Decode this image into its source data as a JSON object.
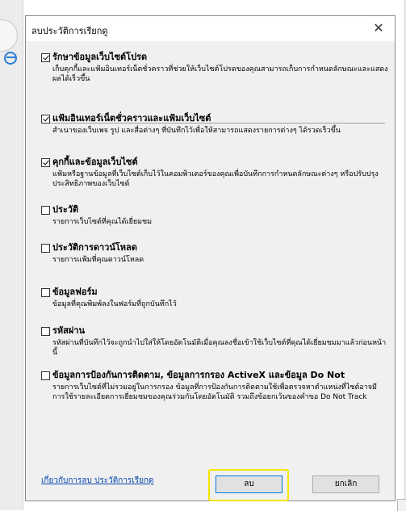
{
  "dialog": {
    "title": "ลบประวัติการเรียกดู",
    "close_label": "✕"
  },
  "options": [
    {
      "checked": true,
      "label": "รักษาข้อมูลเว็บไซต์โปรด",
      "description": "เก็บคุกกี้และแฟ้มอินเทอร์เน็ตชั่วคราวที่ช่วยให้เว็บไซต์โปรดของคุณสามารถเก็บการกำหนดลักษณะและแสดงผลได้เร็วขึ้น"
    },
    {
      "checked": true,
      "label": "แฟ้มอินเทอร์เน็ตชั่วคราวและแฟ้มเว็บไซต์",
      "description": "สำเนาของเว็บเพจ รูป และสื่อต่างๆ ที่บันทึกไว้เพื่อให้สามารถแสดงรายการต่างๆ ได้รวดเร็วขึ้น"
    },
    {
      "checked": true,
      "label": "คุกกี้และข้อมูลเว็บไซต์",
      "description": "แฟ้มหรือฐานข้อมูลที่เว็บไซต์เก็บไว้ในคอมพิวเตอร์ของคุณเพื่อบันทึกการกำหนดลักษณะต่างๆ หรือปรับปรุงประสิทธิภาพของเว็บไซต์"
    },
    {
      "checked": false,
      "label": "ประวัติ",
      "description": "รายการเว็บไซต์ที่คุณได้เยี่ยมชม"
    },
    {
      "checked": false,
      "label": "ประวัติการดาวน์โหลด",
      "description": "รายการแฟ้มที่คุณดาวน์โหลด"
    },
    {
      "checked": false,
      "label": "ข้อมูลฟอร์ม",
      "description": "ข้อมูลที่คุณพิมพ์ลงในฟอร์มที่ถูกบันทึกไว้"
    },
    {
      "checked": false,
      "label": "รหัสผ่าน",
      "description": "รหัสผ่านที่บันทึกไว้จะถูกนำไปใส่ให้โดยอัตโนมัติเมื่อคุณลงชื่อเข้าใช้เว็บไซต์ที่คุณได้เยี่ยมชมมาแล้วก่อนหน้านี้"
    },
    {
      "checked": false,
      "label": "ข้อมูลการป้องกันการติดตาม, ข้อมูลการกรอง ActiveX และข้อมูล Do Not",
      "description": "รายการเว็บไซต์ที่ไม่รวมอยู่ในการกรอง ข้อมูลที่การป้องกันการติดตามใช้เพื่อตรวจหาตำแหน่งที่ไซต์อาจมีการใช้รายละเอียดการเยี่ยมชมของคุณร่วมกันโดยอัตโนมัติ รวมถึงข้อยกเว้นของคำขอ Do Not Track"
    }
  ],
  "footer": {
    "link_label": "เกี่ยวกับการลบ ประวัติการเรียกดู",
    "delete_label": "ลบ",
    "cancel_label": "ยกเลิก"
  }
}
